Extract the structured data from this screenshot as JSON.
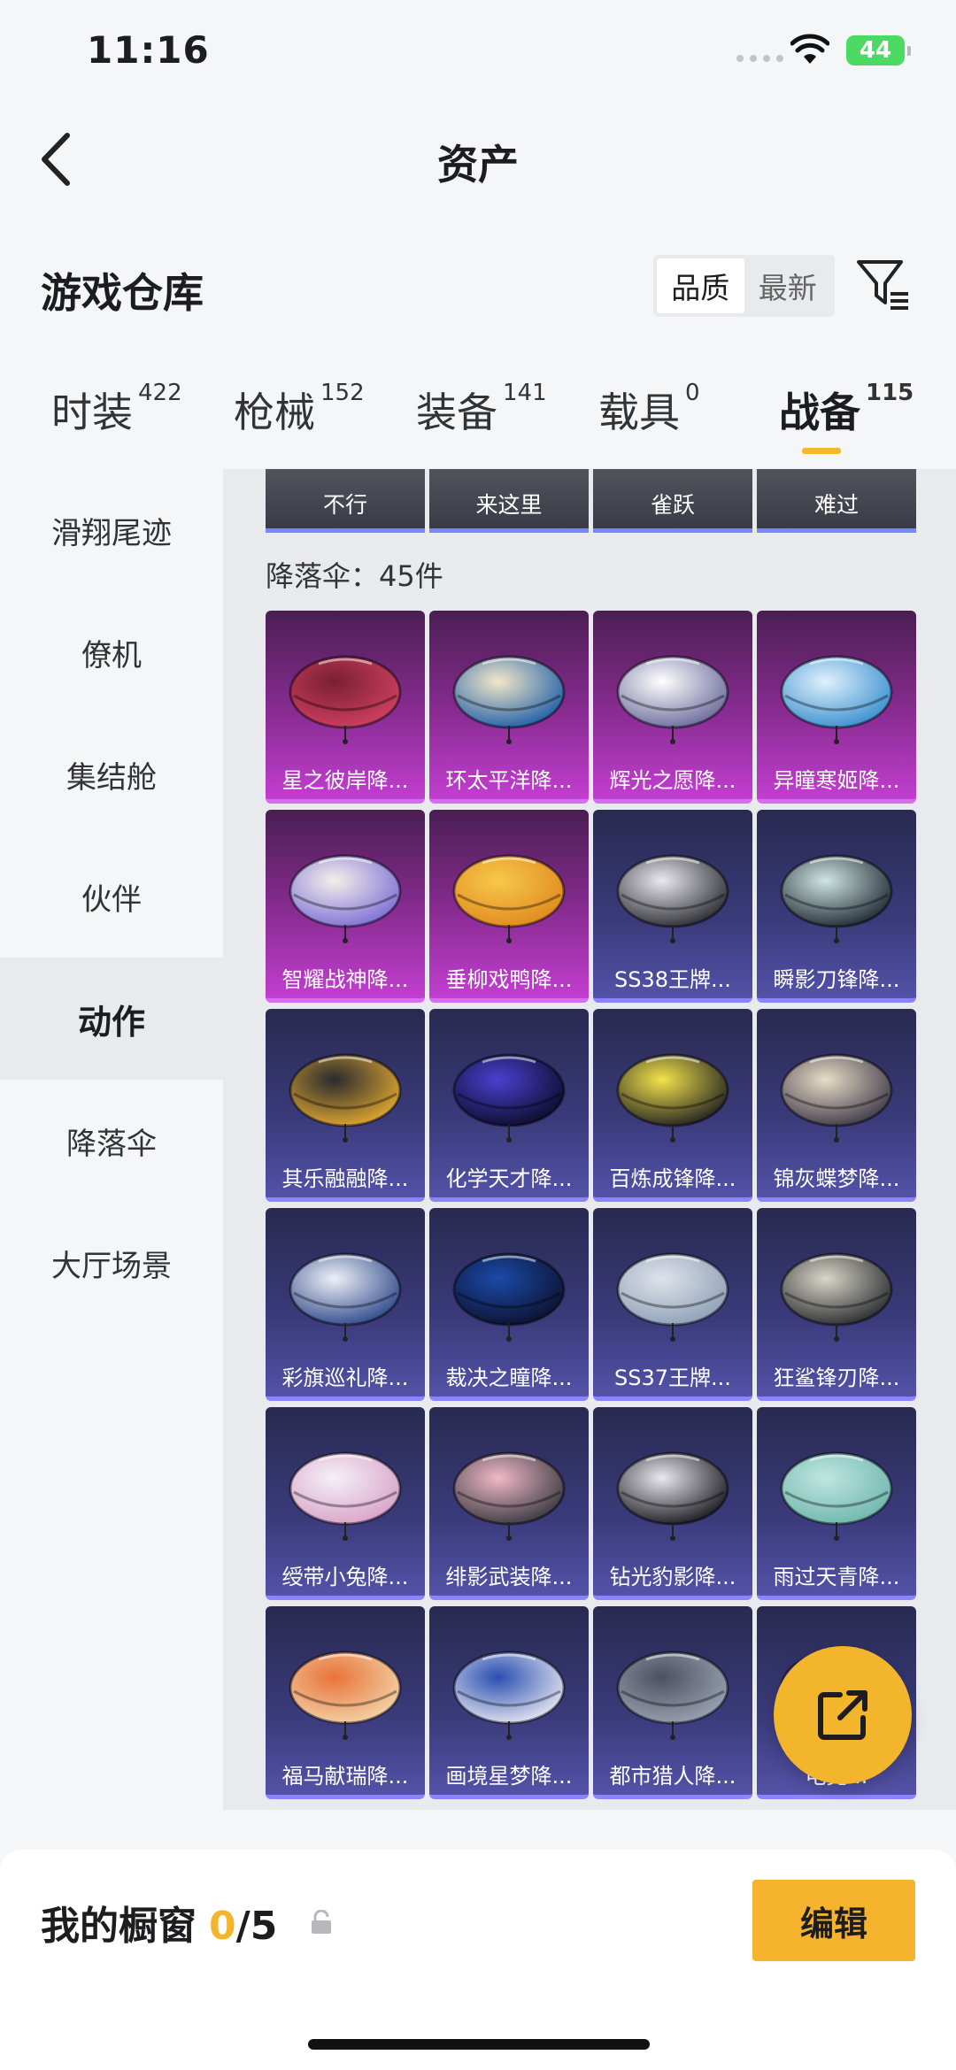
{
  "status_bar": {
    "time": "11:16",
    "battery": "44"
  },
  "nav": {
    "title": "资产",
    "back_icon": "chevron-left-icon"
  },
  "warehouse": {
    "title": "游戏仓库",
    "sort": {
      "quality": "品质",
      "latest": "最新",
      "selected": "品质"
    },
    "filter_icon": "filter-icon"
  },
  "tabs": [
    {
      "label": "时装",
      "count": "422"
    },
    {
      "label": "枪械",
      "count": "152"
    },
    {
      "label": "装备",
      "count": "141"
    },
    {
      "label": "载具",
      "count": "0"
    },
    {
      "label": "战备",
      "count": "115",
      "active": true
    }
  ],
  "sidebar": [
    {
      "label": "滑翔尾迹"
    },
    {
      "label": "僚机"
    },
    {
      "label": "集结舱"
    },
    {
      "label": "伙伴"
    },
    {
      "label": "动作",
      "active": true
    },
    {
      "label": "降落伞"
    },
    {
      "label": "大厅场景"
    }
  ],
  "subtabs": [
    "不行",
    "来这里",
    "雀跃",
    "难过"
  ],
  "section": {
    "label": "降落伞：45件"
  },
  "items": [
    {
      "name": "星之彼岸降...",
      "rarity": "pink",
      "colors": [
        "#7a1f33",
        "#d04060"
      ]
    },
    {
      "name": "环太平洋降...",
      "rarity": "pink",
      "colors": [
        "#f2e7c8",
        "#1f5fa8"
      ]
    },
    {
      "name": "辉光之愿降...",
      "rarity": "pink",
      "colors": [
        "#ffffff",
        "#6b6b9c"
      ]
    },
    {
      "name": "异瞳寒姬降...",
      "rarity": "pink",
      "colors": [
        "#dff1fb",
        "#3a8fd0"
      ]
    },
    {
      "name": "智耀战神降...",
      "rarity": "pink",
      "colors": [
        "#f3efe9",
        "#7d6fd6"
      ]
    },
    {
      "name": "垂柳戏鸭降...",
      "rarity": "pink",
      "colors": [
        "#f7c84a",
        "#e08a1e"
      ]
    },
    {
      "name": "SS38王牌...",
      "rarity": "blue",
      "colors": [
        "#e9e9ee",
        "#2b2b33"
      ]
    },
    {
      "name": "瞬影刀锋降...",
      "rarity": "blue",
      "colors": [
        "#cfe6e2",
        "#1f2a33"
      ]
    },
    {
      "name": "其乐融融降...",
      "rarity": "blue",
      "colors": [
        "#2a2a2f",
        "#e0a830"
      ]
    },
    {
      "name": "化学天才降...",
      "rarity": "blue",
      "colors": [
        "#4a3fd0",
        "#0d0d2a"
      ]
    },
    {
      "name": "百炼成锋降...",
      "rarity": "blue",
      "colors": [
        "#f3e34a",
        "#222222"
      ]
    },
    {
      "name": "锦灰蝶梦降...",
      "rarity": "blue",
      "colors": [
        "#e7ddc6",
        "#403a4a"
      ]
    },
    {
      "name": "彩旗巡礼降...",
      "rarity": "blue",
      "colors": [
        "#eef0f7",
        "#2f4a8a"
      ]
    },
    {
      "name": "裁决之瞳降...",
      "rarity": "blue",
      "colors": [
        "#1b4aa8",
        "#0d1230"
      ]
    },
    {
      "name": "SS37王牌...",
      "rarity": "blue",
      "colors": [
        "#dfe3ea",
        "#8fa0b8"
      ]
    },
    {
      "name": "狂鲨锋刃降...",
      "rarity": "blue",
      "colors": [
        "#d9d6c9",
        "#2a2c30"
      ]
    },
    {
      "name": "绶带小兔降...",
      "rarity": "blue",
      "colors": [
        "#f4f0f7",
        "#d9a3c8"
      ]
    },
    {
      "name": "绯影武装降...",
      "rarity": "blue",
      "colors": [
        "#f0b8c8",
        "#3a3a40"
      ]
    },
    {
      "name": "钻光豹影降...",
      "rarity": "blue",
      "colors": [
        "#e8e8ee",
        "#1a1a20"
      ]
    },
    {
      "name": "雨过天青降...",
      "rarity": "blue",
      "colors": [
        "#bfe6e0",
        "#6fb7ad"
      ]
    },
    {
      "name": "福马献瑞降...",
      "rarity": "blue",
      "colors": [
        "#e8733a",
        "#f3d3a8"
      ]
    },
    {
      "name": "画境星梦降...",
      "rarity": "blue",
      "colors": [
        "#2a4fb0",
        "#e6e6f2"
      ]
    },
    {
      "name": "都市猎人降...",
      "rarity": "blue",
      "colors": [
        "#4c5160",
        "#9aa2b2"
      ]
    },
    {
      "name": "电竞...",
      "rarity": "blue",
      "colors": [
        "#3b3b7c",
        "#7a7ad0"
      ]
    }
  ],
  "fab": {
    "icon": "share-external-icon"
  },
  "showcase": {
    "label": "我的橱窗",
    "current": "0",
    "total": "/5",
    "lock_icon": "lock-icon"
  },
  "edit_button": {
    "label": "编辑"
  }
}
